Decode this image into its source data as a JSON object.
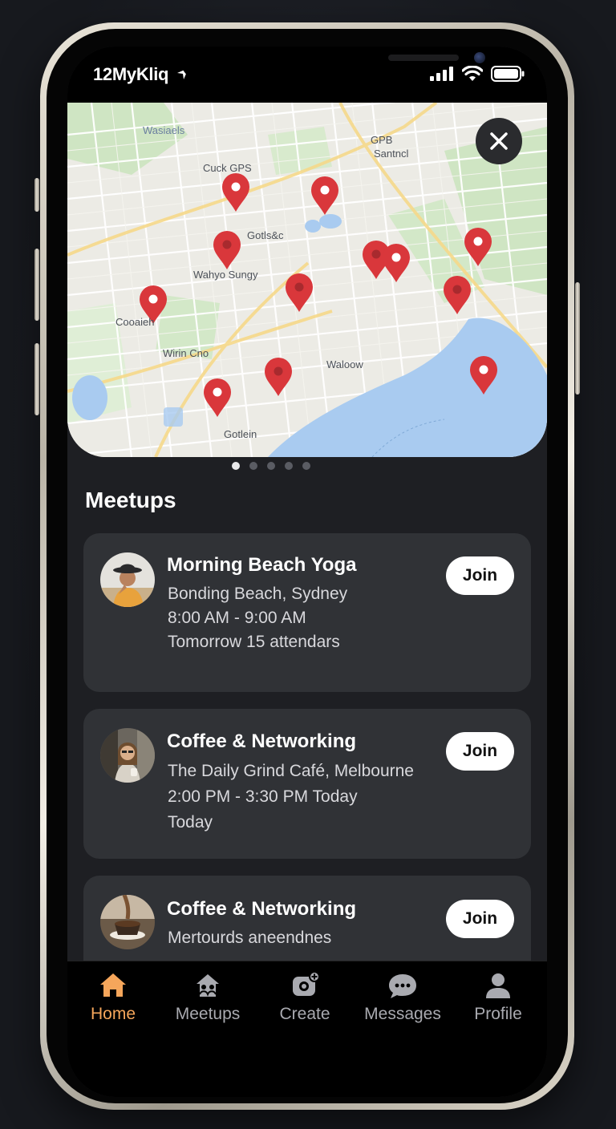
{
  "status_bar": {
    "carrier": "12MyKliq"
  },
  "map": {
    "labels": [
      "Wasiaels",
      "Cuck GPS",
      "GPB",
      "Santncl",
      "Gotls&c",
      "Wahyo Sungy",
      "Cooaieh",
      "Wirin Cno",
      "Waloow",
      "Gotlein"
    ]
  },
  "pager": {
    "count": 5,
    "active_index": 0
  },
  "meetups": {
    "title": "Meetups",
    "cards": [
      {
        "title": "Morning Beach Yoga",
        "line1": "Bonding Beach, Sydney",
        "line2": "8:00 AM - 9:00 AM",
        "line3": "Tomorrow  15 attendars",
        "join_label": "Join"
      },
      {
        "title": "Coffee & Networking",
        "line1": "The Daily Grind Café, Melbourne",
        "line2": "2:00 PM - 3:30 PM  Today",
        "line3": "Today",
        "join_label": "Join"
      },
      {
        "title": "Coffee & Networking",
        "line1": "Mertourds aneendnes",
        "line2": "",
        "line3": "",
        "join_label": "Join"
      }
    ]
  },
  "tab_bar": {
    "tabs": [
      {
        "label": "Home",
        "icon": "home-icon",
        "active": true
      },
      {
        "label": "Meetups",
        "icon": "meetups-icon",
        "active": false
      },
      {
        "label": "Create",
        "icon": "create-icon",
        "active": false
      },
      {
        "label": "Messages",
        "icon": "messages-icon",
        "active": false
      },
      {
        "label": "Profile",
        "icon": "profile-icon",
        "active": false
      }
    ]
  },
  "colors": {
    "accent": "#f5a65b",
    "card_bg": "#303236",
    "pin": "#d9373b",
    "water": "#a9cbf0"
  }
}
